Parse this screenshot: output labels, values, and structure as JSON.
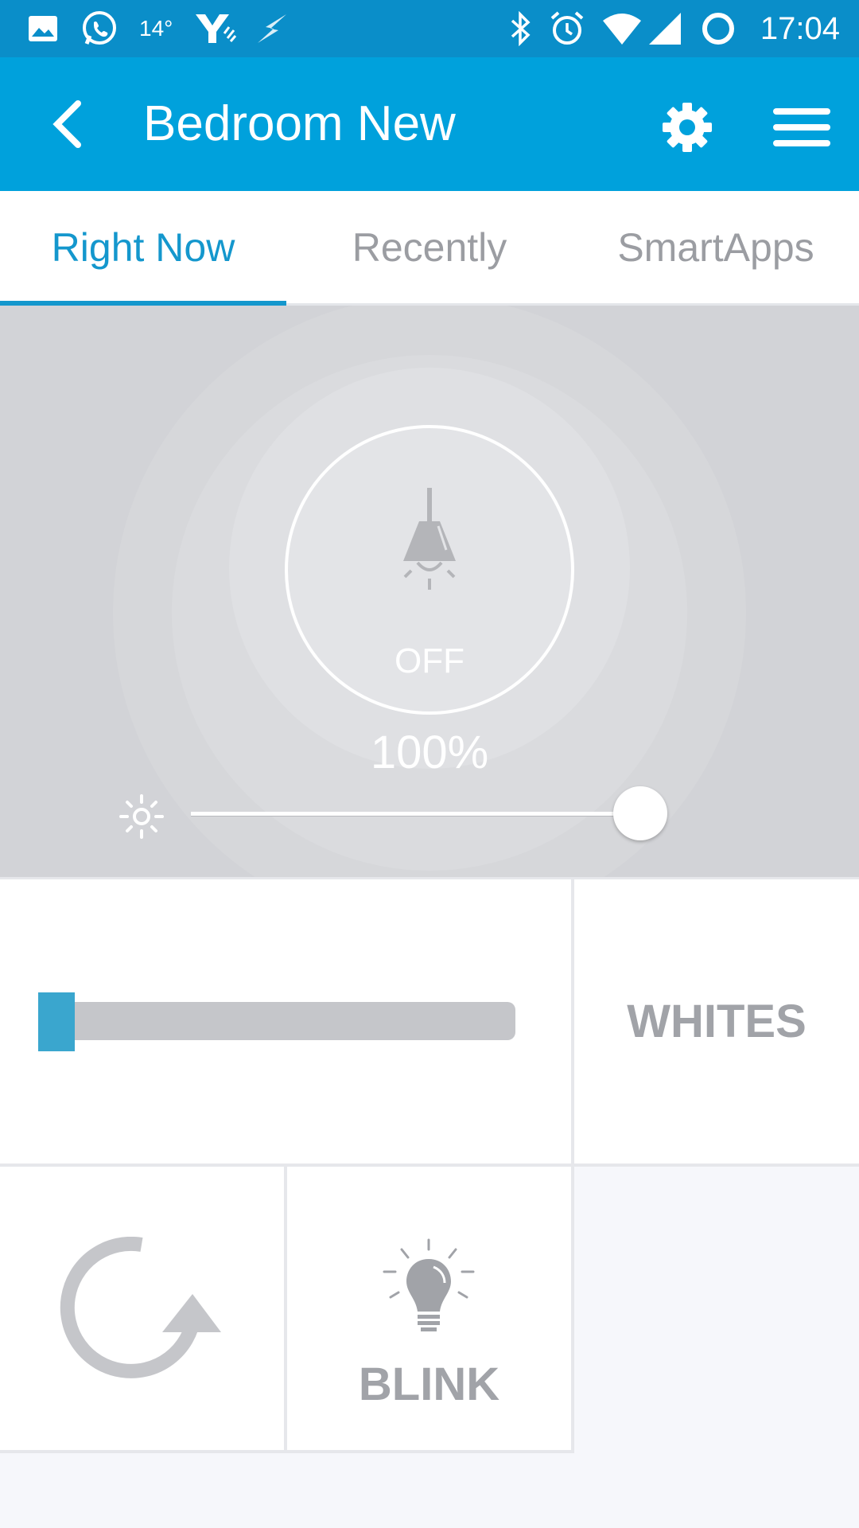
{
  "status_bar": {
    "temperature": "14°",
    "time": "17:04",
    "icons": [
      "image-icon",
      "whatsapp-icon",
      "yahoo-weather-icon",
      "charging-bolt-icon",
      "bluetooth-icon",
      "alarm-icon",
      "wifi-icon",
      "signal-icon",
      "sync-icon"
    ]
  },
  "app_bar": {
    "title": "Bedroom New",
    "back_icon": "chevron-left-icon",
    "settings_icon": "gear-icon",
    "menu_icon": "hamburger-menu-icon"
  },
  "tabs": [
    {
      "label": "Right Now",
      "active": true
    },
    {
      "label": "Recently",
      "active": false
    },
    {
      "label": "SmartApps",
      "active": false
    }
  ],
  "device": {
    "state": "OFF",
    "level": "100%",
    "level_fraction": 1.0,
    "icon": "pendant-lamp-icon",
    "brightness_icon": "brightness-icon"
  },
  "tiles": {
    "color_slider_value": 0.0,
    "whites_label": "WHITES",
    "refresh_icon": "refresh-icon",
    "blink_label": "BLINK",
    "blink_icon": "lightbulb-icon"
  },
  "colors": {
    "status_bar": "#0a8ec9",
    "app_bar": "#00a1dc",
    "accent": "#1497cd",
    "hero_bg": "#d2d3d7",
    "tile_text": "#a1a3a8"
  }
}
